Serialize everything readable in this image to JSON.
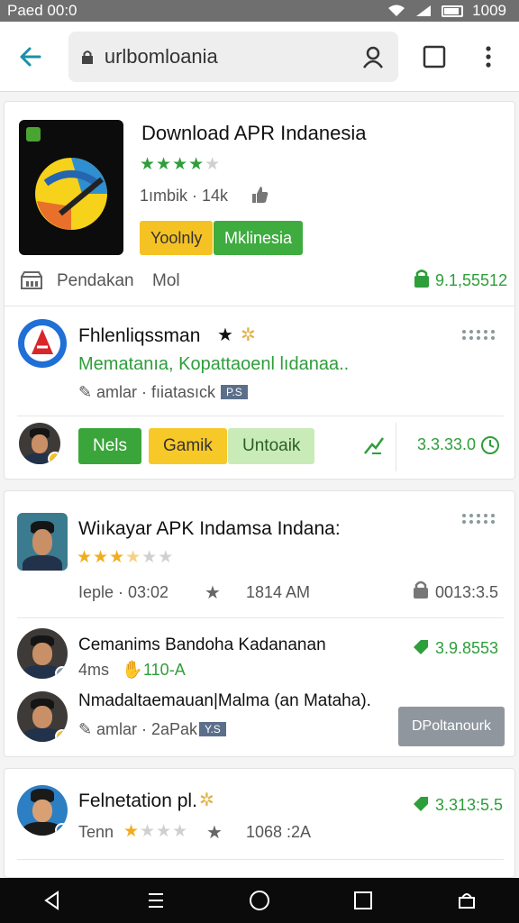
{
  "status_bar": {
    "time": "Paed 00:0",
    "clock": "1009"
  },
  "toolbar": {
    "url": "urlbomloania"
  },
  "card1": {
    "title": "Download APR Indanesia",
    "rating": 4,
    "meta": "1ımbik · 14k",
    "tag_yellow": "Yoolnly",
    "tag_green": "Mklinesia",
    "footer_left": "Pendakan",
    "footer_left2": "Mol",
    "footer_right": "9.1,55512",
    "item": {
      "title": "Fhlenliqssman",
      "desc": "Mematanıa, Kopattaoenl lıdanaa..",
      "meta": "amlar · fıiatasıck",
      "meta_badge": "P.S"
    },
    "actions": {
      "btn1": "Nels",
      "btn2": "Gamik",
      "btn3": "Untoaik",
      "count": "3.3.33.0"
    }
  },
  "card2": {
    "title": "Wiıkayar APK Indamsa Indana:",
    "rating": 3.5,
    "meta_left": "Ieple · 03:02",
    "meta_time": "1814 AM",
    "meta_right": "0013:3.5",
    "row1": {
      "title": "Cemanims Bandoha Kadananan",
      "meta": "4ms",
      "tag": "110-A",
      "right": "3.9.8553"
    },
    "row2": {
      "title": "Nmadaltaemauan|Malma (an Mataha).",
      "meta": "amlar · 2aPak",
      "meta_badge": "Y.S",
      "button": "DPoltanourk"
    }
  },
  "card3": {
    "title": "Felnetation pl.",
    "meta_left": "Tenn",
    "rating": 2,
    "meta_time": "1068 :2A",
    "right": "3.313:5.5"
  }
}
